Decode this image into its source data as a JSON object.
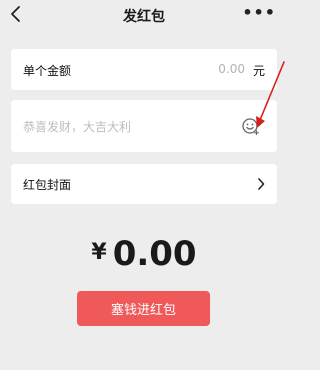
{
  "header": {
    "title": "发红包",
    "back_icon": "chevron-left-icon",
    "more_icon": "more-dots-icon",
    "more_label": "•••"
  },
  "amount": {
    "label": "单个金额",
    "value": "0.00",
    "unit": "元"
  },
  "greeting": {
    "placeholder": "恭喜发财，大吉大利",
    "emoji_icon": "emoji-smile-icon"
  },
  "cover": {
    "label": "红包封面",
    "chevron_icon": "chevron-right-icon"
  },
  "total": {
    "currency": "¥",
    "value": "0.00"
  },
  "submit": {
    "label": "塞钱进红包"
  },
  "colors": {
    "background": "#ededed",
    "button": "#f0595a",
    "annotation_arrow": "#d81e1e"
  }
}
